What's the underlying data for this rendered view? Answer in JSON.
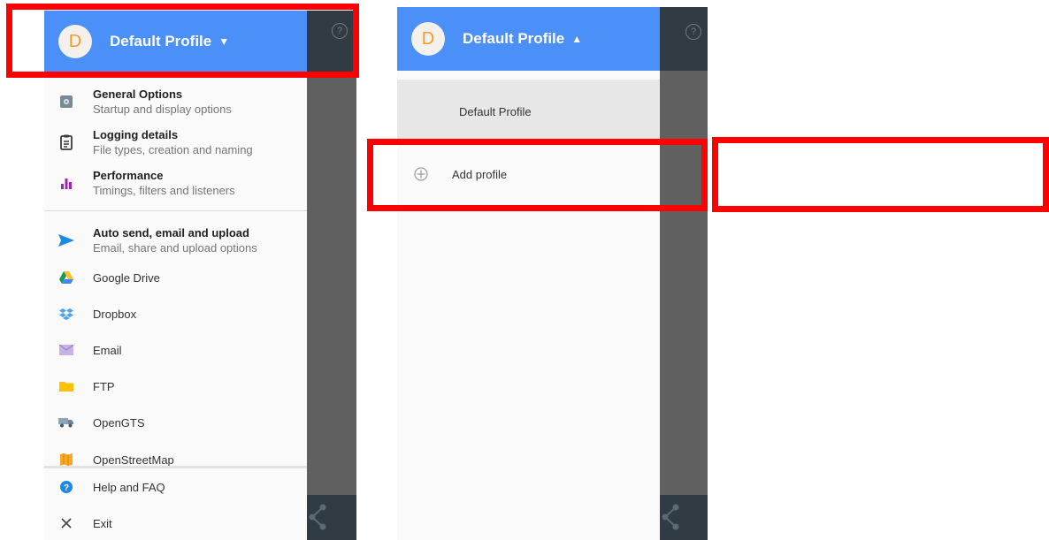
{
  "left_screen": {
    "header": {
      "avatar_letter": "D",
      "title": "Default Profile",
      "caret": "▼"
    },
    "help_symbol": "?",
    "menu": [
      {
        "title": "General Options",
        "subtitle": "Startup and display options",
        "icon": "gear-icon"
      },
      {
        "title": "Logging details",
        "subtitle": "File types, creation and naming",
        "icon": "clipboard-icon"
      },
      {
        "title": "Performance",
        "subtitle": "Timings, filters and listeners",
        "icon": "bar-chart-icon"
      },
      {
        "title": "Auto send, email and upload",
        "subtitle": "Email, share and upload options",
        "icon": "send-icon"
      },
      {
        "label": "Google Drive",
        "icon": "google-drive-icon"
      },
      {
        "label": "Dropbox",
        "icon": "dropbox-icon"
      },
      {
        "label": "Email",
        "icon": "email-icon"
      },
      {
        "label": "FTP",
        "icon": "folder-icon"
      },
      {
        "label": "OpenGTS",
        "icon": "truck-icon"
      },
      {
        "label": "OpenStreetMap",
        "icon": "map-icon"
      },
      {
        "label": "Help and FAQ",
        "icon": "help-icon"
      },
      {
        "label": "Exit",
        "icon": "close-icon"
      }
    ]
  },
  "right_screen": {
    "header": {
      "avatar_letter": "D",
      "title": "Default Profile",
      "caret": "▲"
    },
    "help_symbol": "?",
    "profiles": [
      {
        "label": "Default Profile"
      },
      {
        "label": "Add profile",
        "icon": "add-circle-icon"
      }
    ]
  },
  "colors": {
    "header_blue": "#4b8ff8",
    "highlight_red": "#ff0000",
    "dark_overlay": "#606060",
    "appbar_dark": "#313b43"
  }
}
